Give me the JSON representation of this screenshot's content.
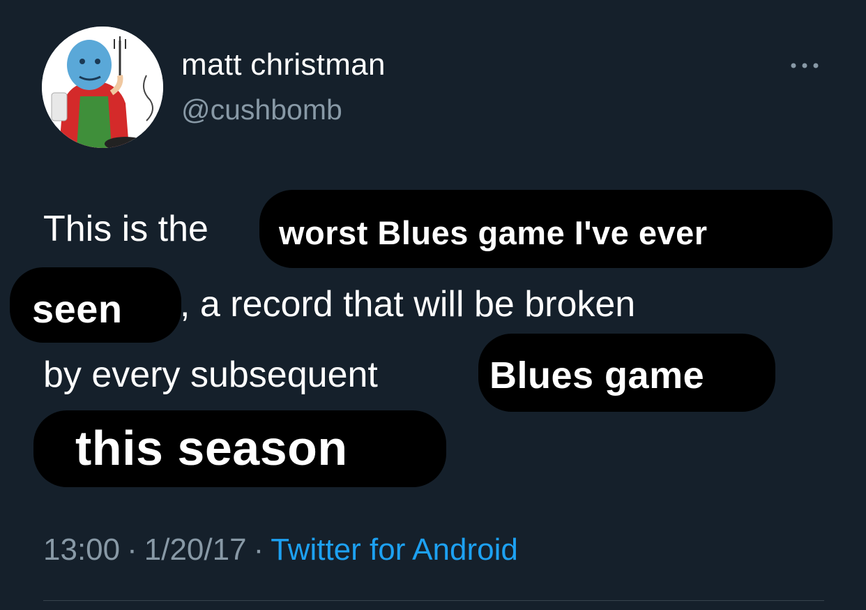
{
  "tweet": {
    "author": {
      "display_name": "matt christman",
      "handle": "@cushbomb"
    },
    "more_icon": "ellipsis-horizontal-icon",
    "body": {
      "line1_prefix": "This is the",
      "redaction1": "worst Blues game I've ever",
      "redaction2": "seen",
      "line2_suffix": ", a record that will be broken",
      "line3_prefix": "by every subsequent",
      "redaction3": "Blues game",
      "redaction4": "this season"
    },
    "meta": {
      "time": "13:00",
      "date": "1/20/17",
      "separator": "·",
      "source": "Twitter for Android"
    }
  },
  "colors": {
    "background": "#15202b",
    "text": "#ffffff",
    "secondary": "#8899a6",
    "link": "#1da1f2",
    "redaction": "#000000"
  }
}
